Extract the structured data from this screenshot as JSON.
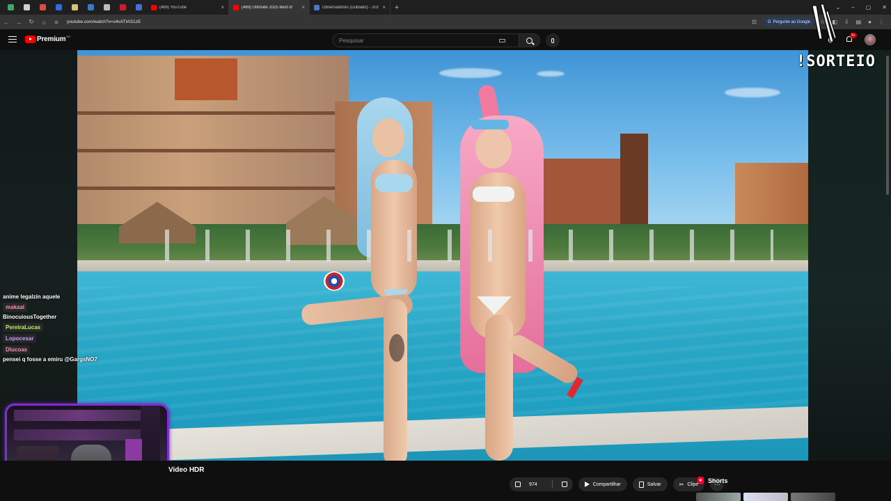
{
  "browser": {
    "pinned_tabs": [
      {
        "name": "code-icon",
        "color": "#3aa86b"
      },
      {
        "name": "chrome-icon",
        "color": "#cfcfcf"
      },
      {
        "name": "circle-red-icon",
        "color": "#e34b3c"
      },
      {
        "name": "d-icon",
        "color": "#2f6fd6"
      },
      {
        "name": "shield-icon",
        "color": "#d9c074"
      },
      {
        "name": "steam-icon",
        "color": "#3a7bbf"
      },
      {
        "name": "doc-icon",
        "color": "#bdbdbd"
      },
      {
        "name": "pin-red-icon",
        "color": "#c4202e"
      },
      {
        "name": "blue-dot-icon",
        "color": "#3b73e6"
      }
    ],
    "tabs": [
      {
        "title": "(489) YouTube",
        "favicon_color": "#ff0000",
        "active": false,
        "width": 118
      },
      {
        "title": "(489) Ultimate 2025 Best of",
        "favicon_color": "#ff0000",
        "active": true,
        "width": 116
      },
      {
        "title": "Observadores (Dublado) - 202",
        "favicon_color": "#4a78c8",
        "active": false,
        "width": 116
      }
    ],
    "close_glyph": "×",
    "new_tab_glyph": "+",
    "url": "youtube.com/watch?v=s4vATtAS1zE",
    "google_pill": "Pergunte ao Google"
  },
  "youtube": {
    "brand": "Premium",
    "region": "BR",
    "search_placeholder": "Pesquisar",
    "notification_badge": "9+"
  },
  "overlay": {
    "sorteio": "!SORTEIO",
    "chat": [
      {
        "type": "msg",
        "text": "anime legalzin aquele"
      },
      {
        "type": "user",
        "name": "makaal",
        "color": "u-pink"
      },
      {
        "type": "msg",
        "text": "BinocuiousTogether"
      },
      {
        "type": "user",
        "name": "PereiraLucas",
        "color": "u-green"
      },
      {
        "type": "user",
        "name": "Lopocesar",
        "color": "u-violet"
      },
      {
        "type": "user",
        "name": "Dlucoas",
        "color": "u-pink"
      },
      {
        "type": "msg",
        "text": "pensei q fosse a emiru @GargsNO7"
      }
    ]
  },
  "video": {
    "title_partial": "Video HDR"
  },
  "actions": {
    "likes": "974",
    "share": "Compartilhar",
    "save": "Salvar",
    "clip": "Clipe",
    "more": "···",
    "shorts": "Shorts"
  },
  "colors": {
    "youtube_red": "#ff0000",
    "webcam_border": "#7d2fd0",
    "pill_bg": "#272727"
  }
}
